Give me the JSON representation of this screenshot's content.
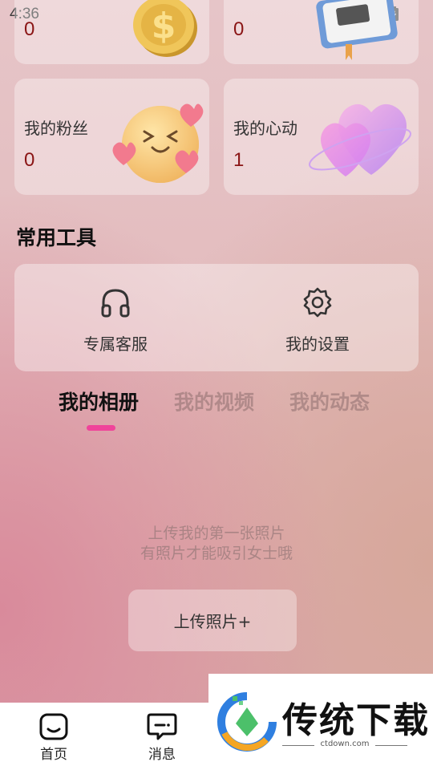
{
  "status_bar": {
    "time": "4:36"
  },
  "stats": {
    "top_left": {
      "value": "0"
    },
    "top_right": {
      "value": "0"
    },
    "fans": {
      "label": "我的粉丝",
      "value": "0"
    },
    "likes": {
      "label": "我的心动",
      "value": "1"
    }
  },
  "tools": {
    "title": "常用工具",
    "items": [
      {
        "label": "专属客服",
        "icon": "headphones-icon"
      },
      {
        "label": "我的设置",
        "icon": "gear-icon"
      }
    ]
  },
  "tabs": [
    {
      "label": "我的相册",
      "active": true
    },
    {
      "label": "我的视频",
      "active": false
    },
    {
      "label": "我的动态",
      "active": false
    }
  ],
  "album": {
    "empty_line1": "上传我的第一张照片",
    "empty_line2": "有照片才能吸引女士哦",
    "upload_button": "上传照片+"
  },
  "bottom_nav": [
    {
      "label": "首页",
      "icon": "home-face-icon"
    },
    {
      "label": "消息",
      "icon": "message-icon"
    }
  ],
  "watermark": {
    "title": "传统下载",
    "url": "ctdown.com"
  },
  "colors": {
    "accent": "#f0439a",
    "value_red": "#8a1515"
  }
}
